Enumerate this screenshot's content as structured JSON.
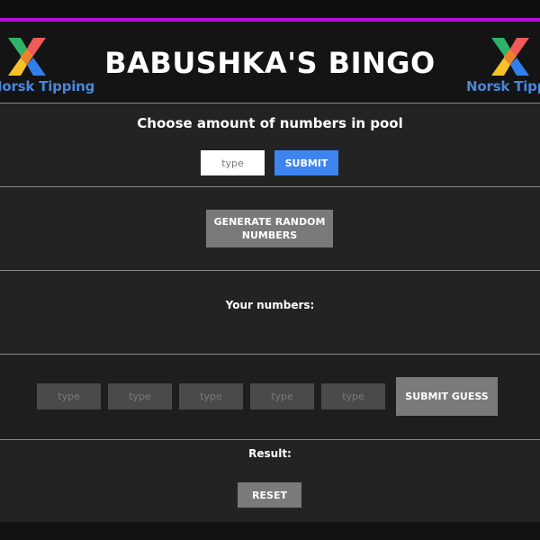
{
  "colors": {
    "accent": "#b80fdd",
    "brand_blue": "#4a86d9",
    "submit_blue": "#3e84f0",
    "button_gray": "#7a7a7a"
  },
  "header": {
    "title": "BABUSHKA'S BINGO",
    "logo_left_text": "Norsk Tipping",
    "logo_right_text": "Norsk Tipping",
    "logo_icon": "norsk-tipping-logo-icon"
  },
  "pool": {
    "heading": "Choose amount of numbers in pool",
    "input_placeholder": "type",
    "submit_label": "SUBMIT"
  },
  "generate": {
    "button_label": "GENERATE RANDOM NUMBERS"
  },
  "numbers": {
    "heading": "Your numbers:"
  },
  "guess": {
    "inputs": [
      {
        "placeholder": "type"
      },
      {
        "placeholder": "type"
      },
      {
        "placeholder": "type"
      },
      {
        "placeholder": "type"
      },
      {
        "placeholder": "type"
      }
    ],
    "submit_label": "SUBMIT GUESS"
  },
  "result": {
    "heading": "Result:",
    "reset_label": "RESET"
  }
}
